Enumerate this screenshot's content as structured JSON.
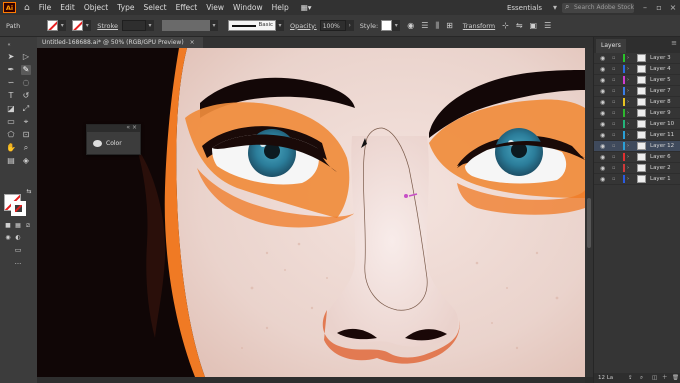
{
  "app": {
    "logo_text": "Ai"
  },
  "menu": [
    "File",
    "Edit",
    "Object",
    "Type",
    "Select",
    "Effect",
    "View",
    "Window",
    "Help"
  ],
  "menu_right": {
    "workspace": "Essentials",
    "search_placeholder": "Search Adobe Stock"
  },
  "control_bar": {
    "selection_label": "Path",
    "stroke_label": "Stroke",
    "brush_label": "Basic",
    "opacity_label": "Opacity:",
    "opacity_value": "100%",
    "style_label": "Style:",
    "transform_label": "Transform"
  },
  "document_tab": {
    "title": "Untitled-168688.ai* @ 50% (RGB/GPU Preview)",
    "close": "×"
  },
  "color_panel": {
    "label": "Color",
    "controls": "«  ×"
  },
  "layers_panel": {
    "tab": "Layers",
    "menu_icon": "≡",
    "rows": [
      {
        "name": "Layer 3",
        "color": "#29c429",
        "selected": false
      },
      {
        "name": "Layer 4",
        "color": "#2a6be0",
        "selected": false
      },
      {
        "name": "Layer 5",
        "color": "#d03ccf",
        "selected": false
      },
      {
        "name": "Layer 7",
        "color": "#3a7ee8",
        "selected": false
      },
      {
        "name": "Layer 8",
        "color": "#e8c322",
        "selected": false
      },
      {
        "name": "Layer 9",
        "color": "#2eb82e",
        "selected": false
      },
      {
        "name": "Layer 10",
        "color": "#23b47a",
        "selected": false
      },
      {
        "name": "Layer 11",
        "color": "#2aa0d6",
        "selected": false
      },
      {
        "name": "Layer 12",
        "color": "#2aa0d6",
        "selected": true
      },
      {
        "name": "Layer 6",
        "color": "#e03030",
        "selected": false
      },
      {
        "name": "Layer 2",
        "color": "#d03a3a",
        "selected": false
      },
      {
        "name": "Layer 1",
        "color": "#2a5be0",
        "selected": false
      }
    ],
    "footer_count": "12 La"
  },
  "colors": {
    "accent_orange": "#ff7c00",
    "skin": "#f2dfda",
    "iris": "#2b7d9a",
    "selection_path": "#7a5a4a"
  }
}
